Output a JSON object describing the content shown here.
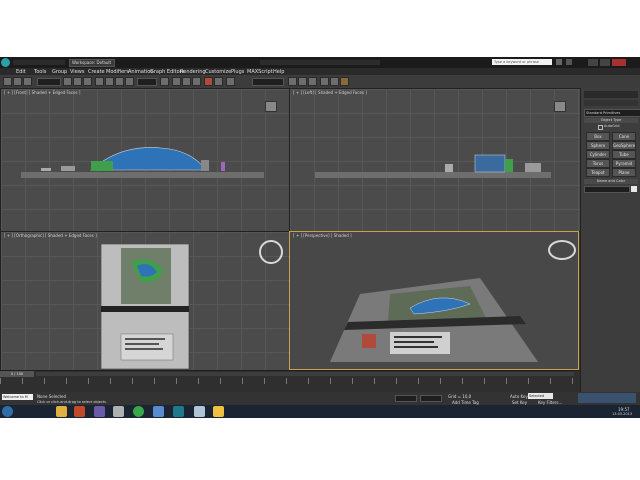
{
  "window": {
    "title": "Workspace: Default",
    "search_placeholder": "Type a keyword or phrase"
  },
  "menu": [
    "Edit",
    "Tools",
    "Group",
    "Views",
    "Create",
    "Modifiers",
    "Animation",
    "Graph Editors",
    "Rendering",
    "Customize",
    "Plugs",
    "MAXScript",
    "Help"
  ],
  "viewports": {
    "top_left": "[ + ] [Front] [ Shaded + Edged Faces ]",
    "top_right": "[ + ] [Left] [ Shaded + Edged Faces ]",
    "bottom_left": "[ + ] [Orthographic] [ Shaded + Edged Faces ]",
    "bottom_right": "[ + ] [Perspective] [ Shaded ]"
  },
  "command_panel": {
    "dropdown": "Standard Primitives",
    "section_object_type": "Object Type",
    "autogrid": "AutoGrid",
    "buttons": [
      "Box",
      "Cone",
      "Sphere",
      "GeoSphere",
      "Cylinder",
      "Tube",
      "Torus",
      "Pyramid",
      "Teapot",
      "Plane"
    ],
    "section_name_color": "Name and Color"
  },
  "timeline": {
    "frame_counter": "0 / 100"
  },
  "status": {
    "selection": "None Selected",
    "prompt": "Click or click-and-drag to select objects",
    "maxscript": "Welcome to M",
    "grid": "Grid = 10,0",
    "auto_key": "Auto Key",
    "selected": "Selected",
    "set_key": "Set Key",
    "key_filters": "Key Filters...",
    "add_time_tag": "Add Time Tag"
  },
  "taskbar": {
    "time": "19:57",
    "date": "13.03.2013"
  },
  "colors": {
    "accent": "#c9a24a",
    "building_glass": "#2e73b8",
    "building_green": "#3f9f4a"
  }
}
